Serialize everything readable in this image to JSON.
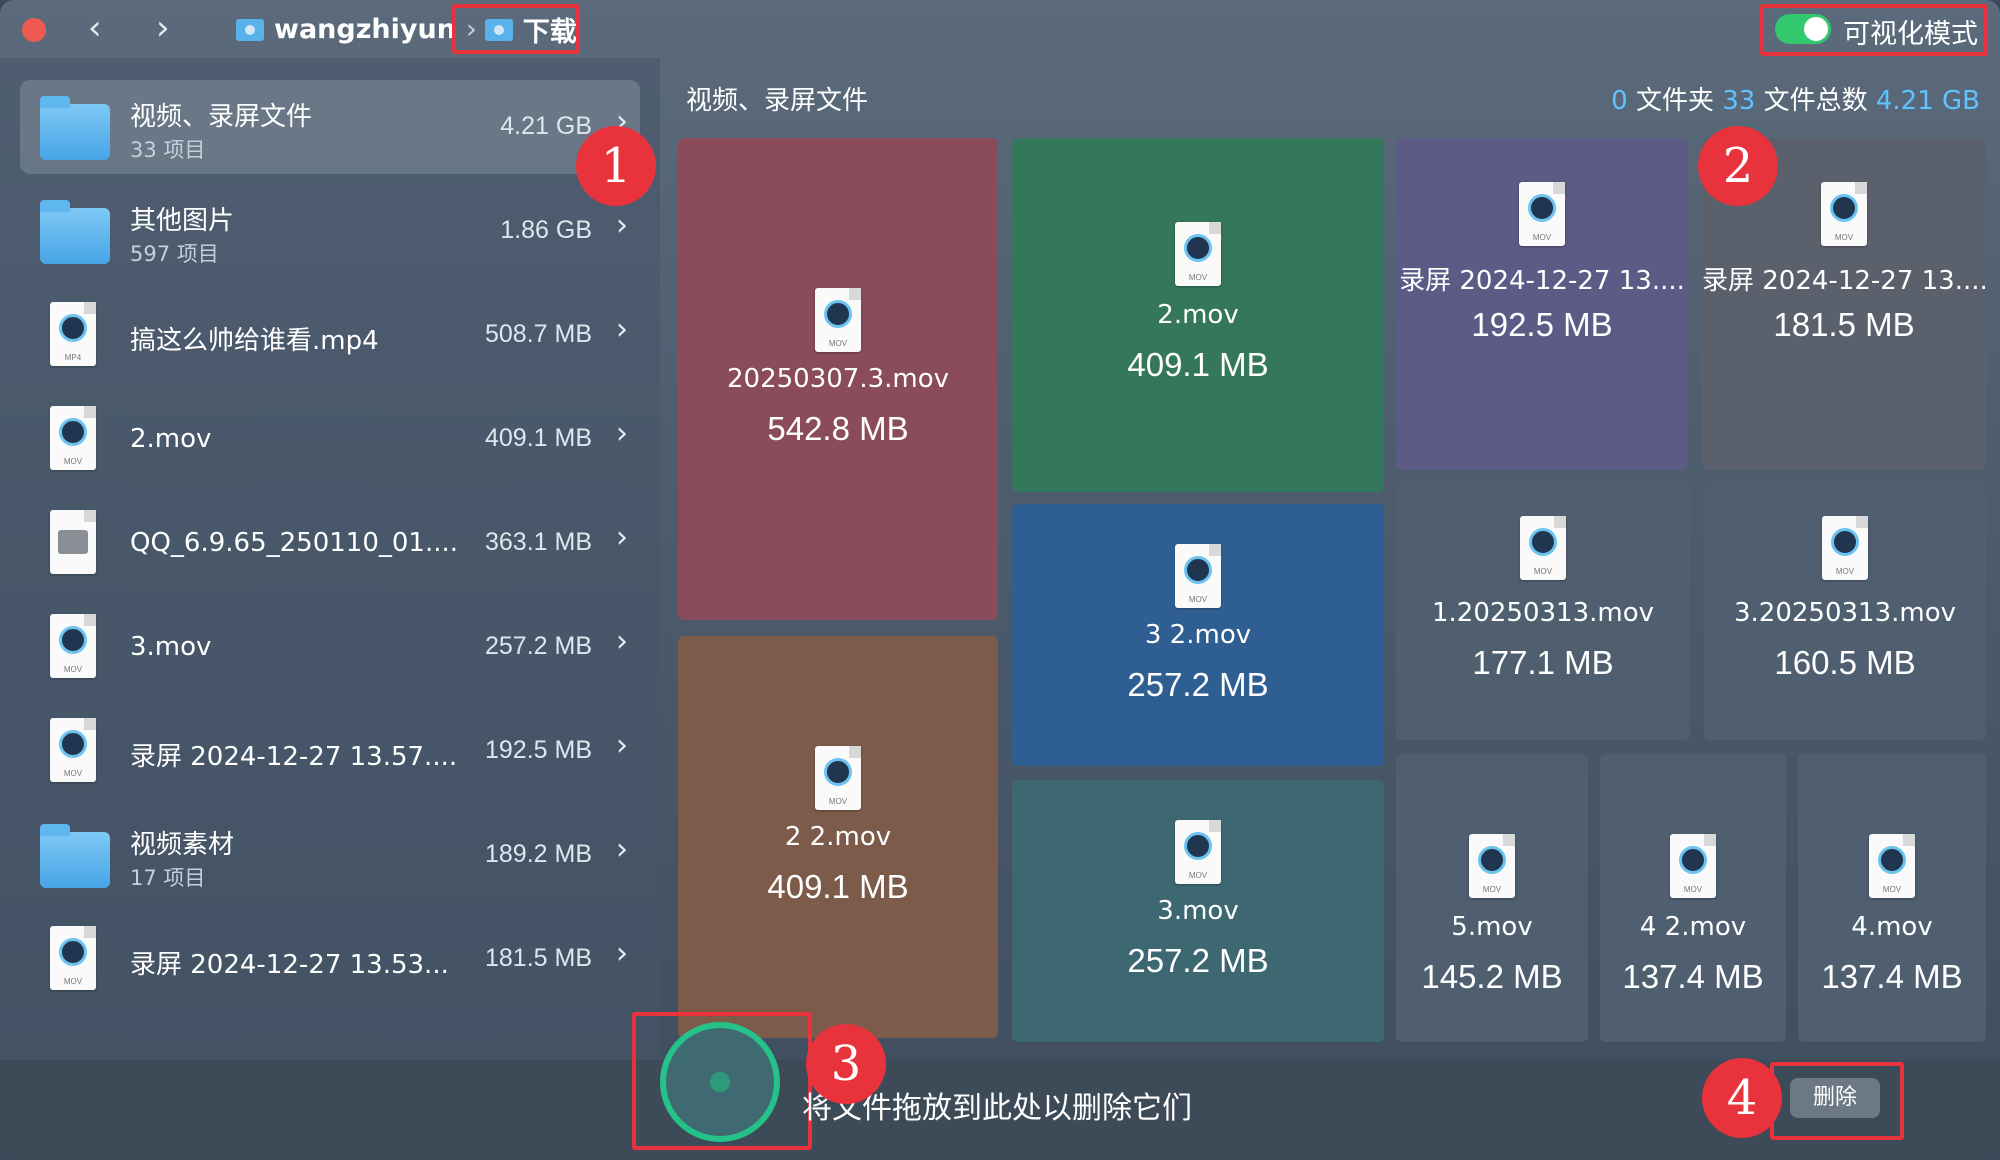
{
  "titlebar": {
    "back": "‹",
    "forward": "›",
    "crumbs": [
      "wangzhiyun",
      "下载"
    ],
    "crumb_sep": "›",
    "mode_label": "可视化模式"
  },
  "sidebar": {
    "items": [
      {
        "name": "视频、录屏文件",
        "sub": "33 项目",
        "size": "4.21 GB",
        "icon": "folder"
      },
      {
        "name": "其他图片",
        "sub": "597 项目",
        "size": "1.86 GB",
        "icon": "folder"
      },
      {
        "name": "搞这么帅给谁看.mp4",
        "size": "508.7 MB",
        "icon": "mov",
        "ext": "MP4"
      },
      {
        "name": "2.mov",
        "size": "409.1 MB",
        "icon": "mov",
        "ext": "MOV"
      },
      {
        "name": "QQ_6.9.65_250110_01....",
        "size": "363.1 MB",
        "icon": "pkg"
      },
      {
        "name": "3.mov",
        "size": "257.2 MB",
        "icon": "mov",
        "ext": "MOV"
      },
      {
        "name": "录屏 2024-12-27 13.57....",
        "size": "192.5 MB",
        "icon": "mov",
        "ext": "MOV"
      },
      {
        "name": "视频素材",
        "sub": "17 项目",
        "size": "189.2 MB",
        "icon": "folder"
      },
      {
        "name": "录屏 2024-12-27 13.53...",
        "size": "181.5 MB",
        "icon": "mov",
        "ext": "MOV"
      }
    ]
  },
  "main": {
    "title": "视频、录屏文件",
    "stats": {
      "folders": "0",
      "folders_label": "文件夹",
      "files": "33",
      "files_label": "文件总数",
      "total": "4.21 GB"
    },
    "tiles": [
      {
        "name": "20250307.3.mov",
        "size": "542.8 MB",
        "color": "#8a4b5b"
      },
      {
        "name": "2 2.mov",
        "size": "409.1 MB",
        "color": "#7c5b4b"
      },
      {
        "name": "2.mov",
        "size": "409.1 MB",
        "color": "#34775a"
      },
      {
        "name": "3 2.mov",
        "size": "257.2 MB",
        "color": "#2f5f92"
      },
      {
        "name": "3.mov",
        "size": "257.2 MB",
        "color": "#3d6872"
      },
      {
        "name": "录屏 2024-12-27 13....",
        "size": "192.5 MB",
        "color": "#5b5b86"
      },
      {
        "name": "录屏 2024-12-27 13....",
        "size": "181.5 MB",
        "color": "#5a606c"
      },
      {
        "name": "1.20250313.mov",
        "size": "177.1 MB",
        "color": "#4f5f70"
      },
      {
        "name": "3.20250313.mov",
        "size": "160.5 MB",
        "color": "#4f5f70"
      },
      {
        "name": "5.mov",
        "size": "145.2 MB",
        "color": "#4f5f70"
      },
      {
        "name": "4 2.mov",
        "size": "137.4 MB",
        "color": "#4f5f70"
      },
      {
        "name": "4.mov",
        "size": "137.4 MB",
        "color": "#4f5f70"
      }
    ]
  },
  "bottom": {
    "drop_text": "将文件拖放到此处以删除它们",
    "delete_label": "删除"
  },
  "badges": [
    "1",
    "2",
    "3",
    "4"
  ]
}
